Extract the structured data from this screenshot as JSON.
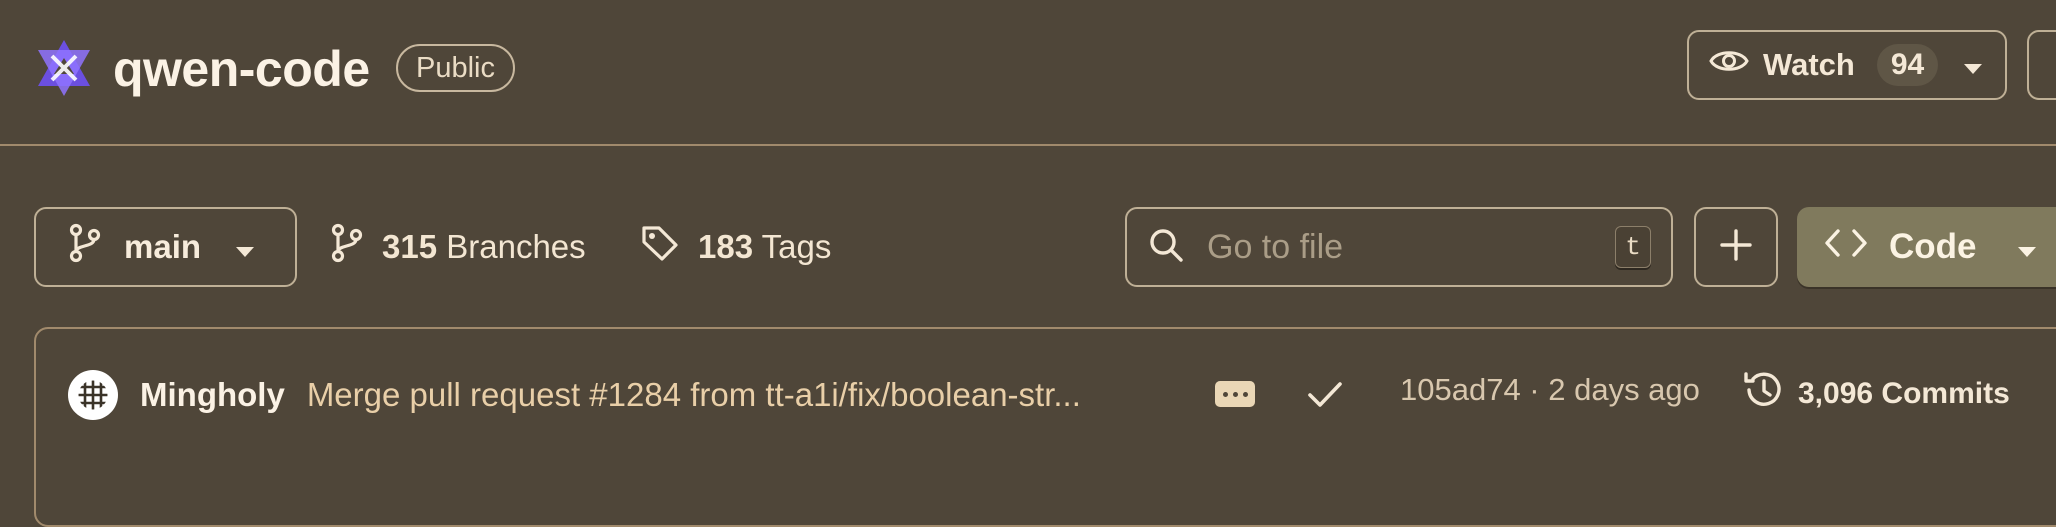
{
  "repo": {
    "name": "qwen-code",
    "visibility": "Public"
  },
  "watch": {
    "label": "Watch",
    "count": "94"
  },
  "toolbar": {
    "branch": "main",
    "branches_count": "315",
    "branches_label": "Branches",
    "tags_count": "183",
    "tags_label": "Tags",
    "search_placeholder": "Go to file",
    "search_shortcut": "t",
    "code_label": "Code"
  },
  "commit": {
    "author": "Mingholy",
    "message": "Merge pull request #1284 from tt-a1i/fix/boolean-str...",
    "hash_time": "105ad74 · 2 days ago",
    "commits_count": "3,096 Commits"
  },
  "colors": {
    "background": "#4f4639",
    "code_button": "#807a5d",
    "commit_message": "#e9cfa8",
    "logo": "#6b4fe0"
  },
  "icons": [
    "qwen-logo-icon",
    "eye-icon",
    "caret-down-icon",
    "git-branch-icon",
    "tag-icon",
    "search-icon",
    "plus-icon",
    "code-icon",
    "ellipsis-icon",
    "check-icon",
    "history-icon"
  ]
}
